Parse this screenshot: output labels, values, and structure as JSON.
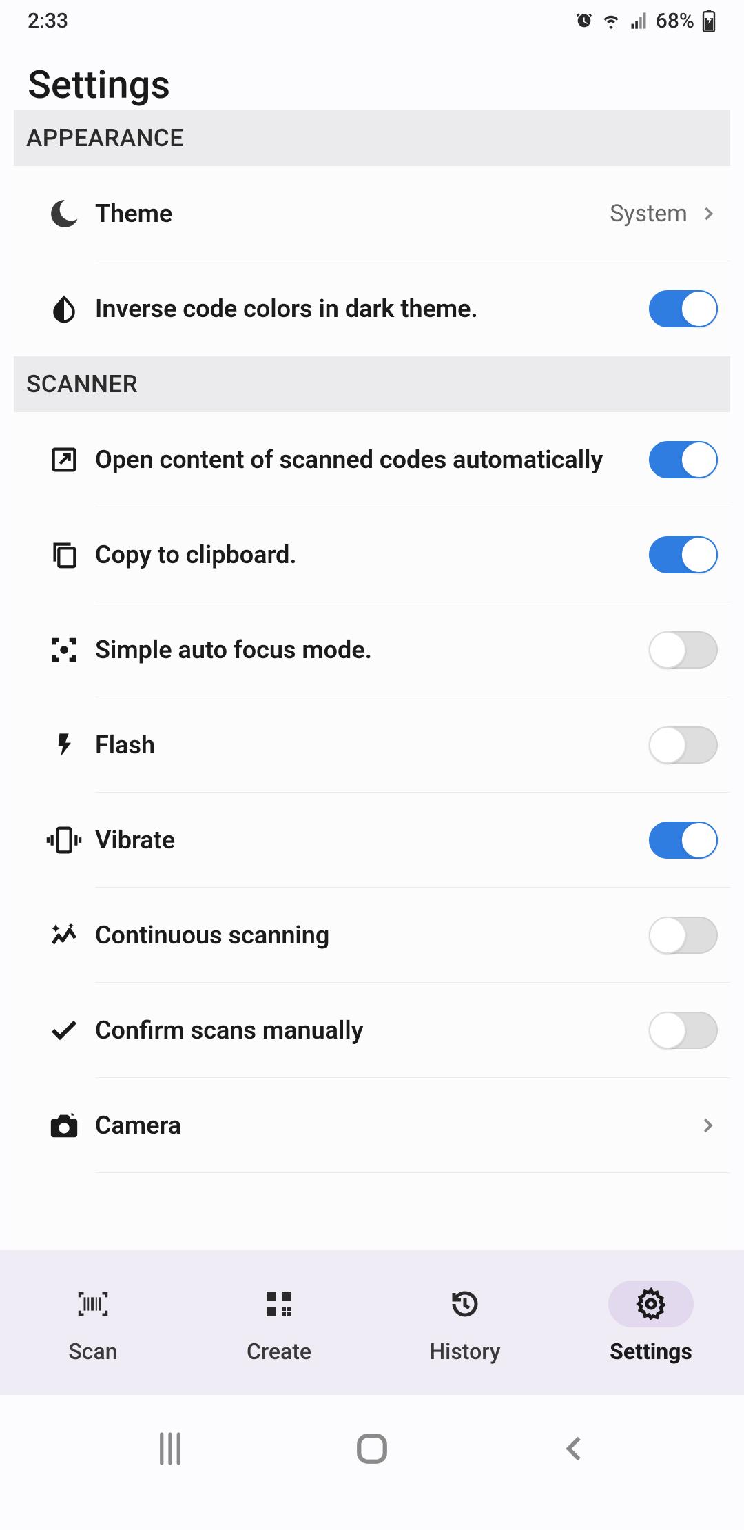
{
  "status": {
    "time": "2:33",
    "battery": "68%"
  },
  "page_title": "Settings",
  "sections": {
    "appearance_header": "APPEARANCE",
    "scanner_header": "SCANNER"
  },
  "settings": {
    "theme": {
      "label": "Theme",
      "value": "System"
    },
    "inverse": {
      "label": "Inverse code colors in dark theme.",
      "on": true
    },
    "open_auto": {
      "label": "Open content of scanned codes automatically",
      "on": true
    },
    "copy_clip": {
      "label": "Copy to clipboard.",
      "on": true
    },
    "simple_focus": {
      "label": "Simple auto focus mode.",
      "on": false
    },
    "flash": {
      "label": "Flash",
      "on": false
    },
    "vibrate": {
      "label": "Vibrate",
      "on": true
    },
    "continuous": {
      "label": "Continuous scanning",
      "on": false
    },
    "confirm": {
      "label": "Confirm scans manually",
      "on": false
    },
    "camera": {
      "label": "Camera"
    }
  },
  "nav": {
    "scan": "Scan",
    "create": "Create",
    "history": "History",
    "settings": "Settings"
  }
}
